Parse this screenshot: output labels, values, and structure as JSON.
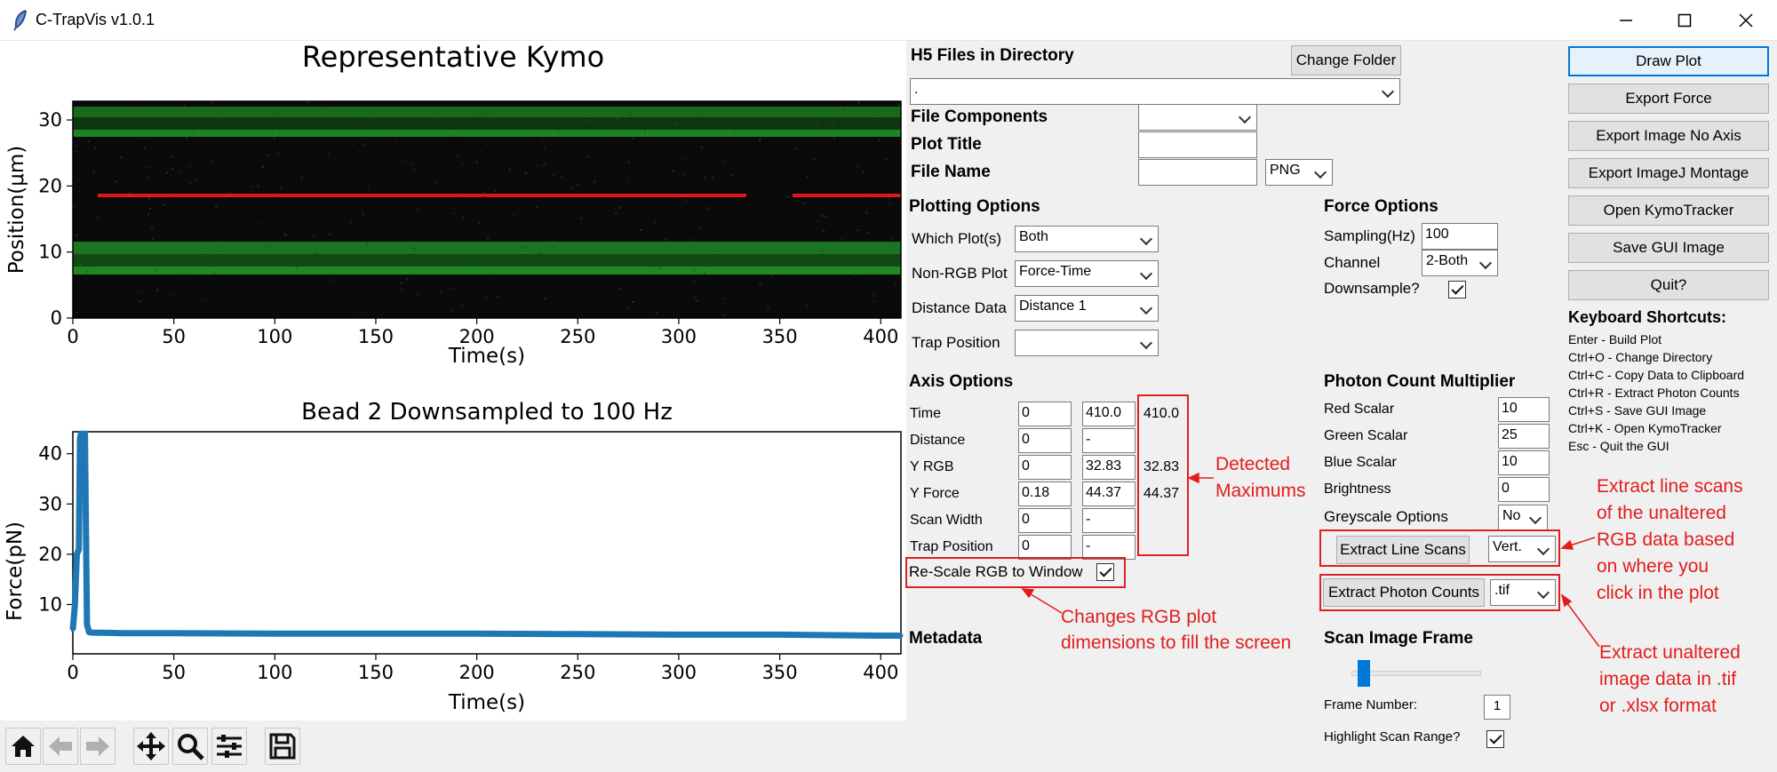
{
  "window": {
    "title": "C-TrapVis v1.0.1"
  },
  "kymo": {
    "title": "Representative Kymo",
    "xlabel": "Time(s)",
    "ylabel": "Position(μm)",
    "xticks": [
      "0",
      "50",
      "100",
      "150",
      "200",
      "250",
      "300",
      "350",
      "400"
    ],
    "yticks": [
      "0",
      "10",
      "20",
      "30"
    ]
  },
  "chart_data": {
    "type": "line",
    "title": "Bead 2 Downsampled to 100 Hz",
    "xlabel": "Time(s)",
    "ylabel": "Force(pN)",
    "xlim": [
      0,
      410
    ],
    "ylim": [
      0.18,
      44.37
    ],
    "xticks": [
      "0",
      "50",
      "100",
      "150",
      "200",
      "250",
      "300",
      "350",
      "400"
    ],
    "yticks": [
      "10",
      "20",
      "30",
      "40"
    ],
    "x": [
      0,
      1,
      2,
      3,
      3.5,
      4,
      5,
      6,
      7,
      8,
      10,
      25,
      50,
      100,
      150,
      200,
      250,
      300,
      350,
      400,
      410
    ],
    "series": [
      {
        "values": [
          5,
          10,
          20,
          21,
          43,
          44,
          43,
          44,
          6,
          4.5,
          4.4,
          4.3,
          4.3,
          4.2,
          4.2,
          4.2,
          4.1,
          4.0,
          4.0,
          3.8,
          3.8
        ]
      }
    ],
    "color": "#1f77b4"
  },
  "files": {
    "header": "H5 Files in Directory",
    "change_folder": "Change Folder",
    "selected_file": ".",
    "file_components_label": "File Components",
    "plot_title_label": "Plot Title",
    "file_name_label": "File Name",
    "format": "PNG"
  },
  "plotting": {
    "header": "Plotting Options",
    "which_label": "Which Plot(s)",
    "which_value": "Both",
    "nonrgb_label": "Non-RGB Plot",
    "nonrgb_value": "Force-Time",
    "distance_label": "Distance Data",
    "distance_value": "Distance 1",
    "trap_label": "Trap Position",
    "trap_value": ""
  },
  "force": {
    "header": "Force Options",
    "sampling_label": "Sampling(Hz)",
    "sampling_value": "100",
    "channel_label": "Channel",
    "channel_value": "2-Both",
    "downsample_label": "Downsample?"
  },
  "axis": {
    "header": "Axis Options",
    "rows": [
      {
        "label": "Time",
        "min": "0",
        "max": "410.0",
        "detected": "410.0"
      },
      {
        "label": "Distance",
        "min": "0",
        "max": "-",
        "detected": ""
      },
      {
        "label": "Y RGB",
        "min": "0",
        "max": "32.83",
        "detected": "32.83"
      },
      {
        "label": "Y Force",
        "min": "0.18",
        "max": "44.37",
        "detected": "44.37"
      },
      {
        "label": "Scan Width",
        "min": "0",
        "max": "-",
        "detected": ""
      },
      {
        "label": "Trap Position",
        "min": "0",
        "max": "-",
        "detected": ""
      }
    ],
    "rescale_label": "Re-Scale RGB to Window",
    "metadata_label": "Metadata"
  },
  "photon": {
    "header": "Photon Count Multiplier",
    "rows": [
      {
        "label": "Red Scalar",
        "value": "10"
      },
      {
        "label": "Green Scalar",
        "value": "25"
      },
      {
        "label": "Blue Scalar",
        "value": "10"
      },
      {
        "label": "Brightness",
        "value": "0"
      }
    ],
    "greyscale_label": "Greyscale Options",
    "greyscale_value": "No",
    "extract_lines": "Extract Line Scans",
    "lines_value": "Vert.",
    "extract_counts": "Extract Photon Counts",
    "counts_value": ".tif"
  },
  "scan": {
    "header": "Scan Image Frame",
    "slider_fraction": 0.05,
    "frame_label": "Frame Number:",
    "frame_value": "1",
    "highlight_label": "Highlight Scan Range?"
  },
  "actions": {
    "buttons": [
      "Draw Plot",
      "Export Force",
      "Export Image No Axis",
      "Export ImageJ Montage",
      "Open KymoTracker",
      "Save GUI Image",
      "Quit?"
    ]
  },
  "shortcuts": {
    "header": "Keyboard Shortcuts:",
    "items": [
      "Enter - Build Plot",
      "Ctrl+O - Change Directory",
      "Ctrl+C - Copy Data to Clipboard",
      "Ctrl+R - Extract Photon Counts",
      "Ctrl+S - Save GUI Image",
      "Ctrl+K - Open KymoTracker",
      "Esc - Quit the GUI"
    ]
  },
  "annotations": {
    "detected_1": "Detected",
    "detected_2": "Maximums",
    "rescale_1": "Changes RGB plot",
    "rescale_2": "dimensions to fill the screen",
    "lines_1": "Extract line scans",
    "lines_2": "of the unaltered",
    "lines_3": "RGB data based",
    "lines_4": "on where you",
    "lines_5": "click in the plot",
    "counts_1": "Extract unaltered",
    "counts_2": "image data in .tif",
    "counts_3": "or .xlsx format"
  },
  "colors": {
    "annotation_red": "#e21d1d",
    "force_line": "#1f77b4",
    "kymo_bg": "#0a0a0a",
    "kymo_green": "#1fa82a",
    "kymo_red": "#e01818"
  }
}
